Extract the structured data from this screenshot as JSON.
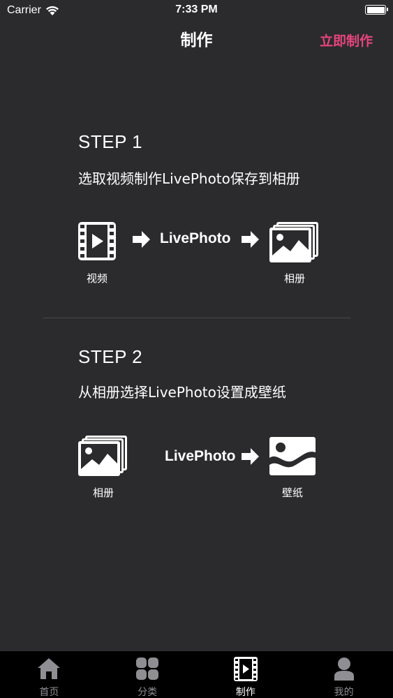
{
  "status_bar": {
    "carrier": "Carrier",
    "time": "7:33 PM"
  },
  "nav": {
    "title": "制作",
    "action": "立即制作",
    "action_color": "#e8457c"
  },
  "step1": {
    "heading": "STEP 1",
    "description": "选取视频制作LivePhoto保存到相册",
    "source_label": "视频",
    "flow_text": "LivePhoto",
    "target_label": "相册",
    "icons": [
      "video-icon",
      "arrow-right-icon",
      "album-icon"
    ]
  },
  "step2": {
    "heading": "STEP 2",
    "description": "从相册选择LivePhoto设置成壁纸",
    "source_label": "相册",
    "flow_text": "LivePhoto",
    "target_label": "壁纸",
    "icons": [
      "album-icon",
      "arrow-right-icon",
      "wallpaper-icon"
    ]
  },
  "tab_bar": {
    "tabs": [
      {
        "label": "首页",
        "icon": "home-icon",
        "active": false
      },
      {
        "label": "分类",
        "icon": "grid-icon",
        "active": false
      },
      {
        "label": "制作",
        "icon": "film-icon",
        "active": true
      },
      {
        "label": "我的",
        "icon": "person-icon",
        "active": false
      }
    ]
  }
}
